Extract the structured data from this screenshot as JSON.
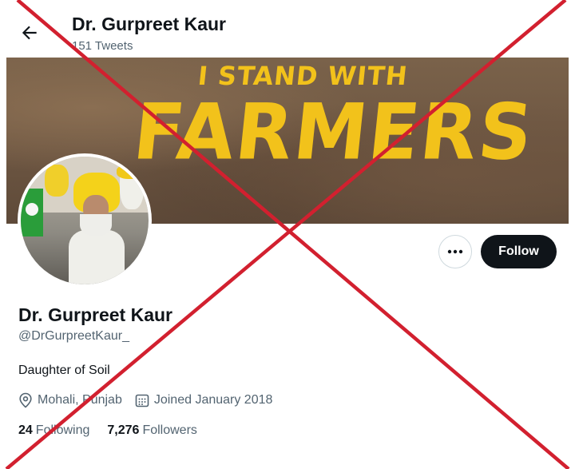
{
  "header": {
    "name": "Dr. Gurpreet Kaur",
    "tweet_count": "151 Tweets"
  },
  "banner": {
    "line1": "I STAND WITH",
    "line2": "FARMERS"
  },
  "actions": {
    "more_label": "•••",
    "follow_label": "Follow"
  },
  "profile": {
    "display_name": "Dr. Gurpreet Kaur",
    "handle": "@DrGurpreetKaur_",
    "bio": "Daughter of Soil",
    "location": "Mohali, Punjab",
    "joined": "Joined January 2018",
    "following_count": "24",
    "following_label": "Following",
    "followers_count": "7,276",
    "followers_label": "Followers"
  },
  "colors": {
    "overlay_cross": "#d2202f",
    "follow_bg": "#0f1419",
    "banner_text": "#f2c21b"
  }
}
